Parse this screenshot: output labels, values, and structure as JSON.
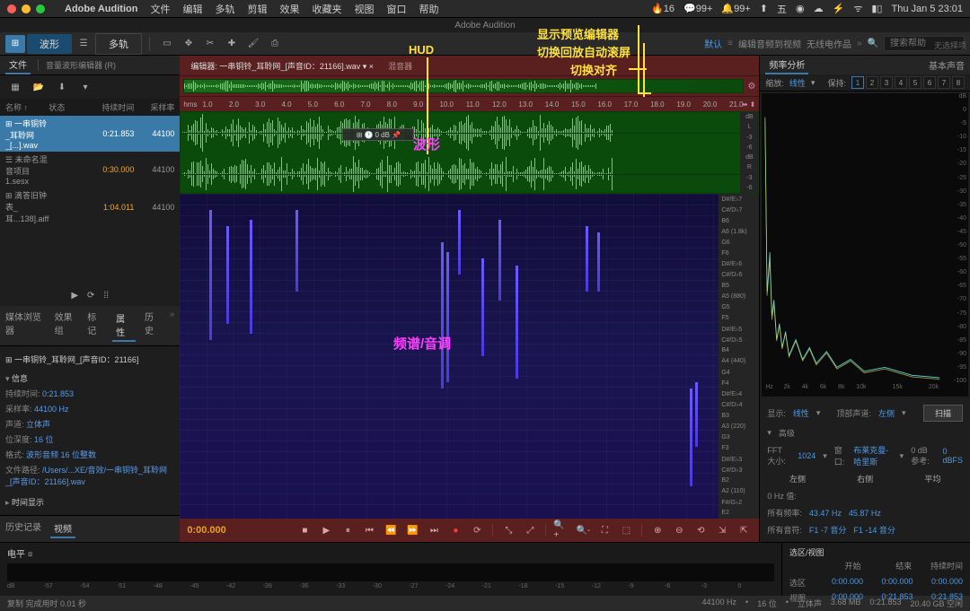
{
  "mac_menu": {
    "app": "Adobe Audition",
    "items": [
      "文件",
      "编辑",
      "多轨",
      "剪辑",
      "效果",
      "收藏夹",
      "视图",
      "窗口",
      "帮助"
    ],
    "right_status": [
      "16",
      "99+",
      "99+",
      "五"
    ],
    "datetime": "Thu Jan 5  23:01"
  },
  "window_title": "Adobe Audition",
  "toolbar": {
    "mode_wave": "波形",
    "mode_multi": "多轨",
    "ws_default": "默认",
    "ws_edit_audio": "编辑音频到视频",
    "ws_radio": "无线电作品",
    "search_placeholder": "搜索帮助"
  },
  "left": {
    "file_tab": "文件",
    "sub_header": "音量波形编辑器 (R)",
    "cols": {
      "name": "名称 ↑",
      "status": "状态",
      "dur": "持续时间",
      "rate": "采样率"
    },
    "files": [
      {
        "name": "一串铜铃_耳聆网_[...].wav",
        "dur": "0:21.853",
        "rate": "44100"
      },
      {
        "name": "未命名混音项目 1.sesx",
        "dur": "0:30.000",
        "rate": "44100"
      },
      {
        "name": "滴答旧钟表_耳...138].aiff",
        "dur": "1:04.011",
        "rate": "44100"
      }
    ],
    "tabs": [
      "媒体浏览器",
      "效果组",
      "标记",
      "属性",
      "历史"
    ],
    "info_title": "一串铜铃_耳聆网_[声音ID：21166]",
    "info_section": "信息",
    "info": {
      "duration_l": "持续时间:",
      "duration": "0:21.853",
      "rate_l": "采样率:",
      "rate": "44100 Hz",
      "channels_l": "声道:",
      "channels": "立体声",
      "depth_l": "位深度:",
      "depth": "16 位",
      "format_l": "格式:",
      "format": "波形音频 16 位整数",
      "path_l": "文件路径:",
      "path": "/Users/...XE/音效/一串铜铃_耳聆网_[声音ID：21166].wav"
    },
    "time_display": "时间显示",
    "history_tab_l": "历史记录",
    "history_tab_r": "视频"
  },
  "center": {
    "tab_prefix": "编辑器:",
    "tab_file": "一串铜铃_耳聆网_[声音ID：21166].wav",
    "tab_mixer": "混音器",
    "hms": "hms",
    "time_marks": [
      "1.0",
      "2.0",
      "3.0",
      "4.0",
      "5.0",
      "6.0",
      "7.0",
      "8.0",
      "9.0",
      "10.0",
      "11.0",
      "12.0",
      "13.0",
      "14.0",
      "15.0",
      "16.0",
      "17.0",
      "18.0",
      "19.0",
      "20.0",
      "21.0"
    ],
    "db_marks": [
      "dB",
      "L",
      "-3",
      "-6",
      "dB",
      "R",
      "-3",
      "-6"
    ],
    "hud": "0 dB",
    "notes": [
      "D#/E♭7",
      "C#/D♭7",
      "B6",
      "A6 (1.8k)",
      "G6",
      "F6",
      "D#/E♭6",
      "C#/D♭6",
      "B5",
      "A5 (880)",
      "G5",
      "F5",
      "D#/E♭5",
      "C#/D♭5",
      "B4",
      "A4 (440)",
      "G4",
      "F4",
      "D#/E♭4",
      "C#/D♭4",
      "B3",
      "A3 (220)",
      "G3",
      "F3",
      "D#/E♭3",
      "C#/D♭3",
      "B2",
      "A2 (110)",
      "F#/G♭2",
      "E2"
    ],
    "timecode": "0:00.000"
  },
  "right": {
    "freq_tab": "频率分析",
    "basic_tab": "基本声音",
    "no_selection": "无选择项",
    "scale_l": "缩放:",
    "scale_v": "线性",
    "hold": "保持:",
    "nums": [
      "1",
      "2",
      "3",
      "4",
      "5",
      "6",
      "7",
      "8"
    ],
    "hz_marks": [
      "Hz",
      "2k",
      "4k",
      "6k",
      "8k",
      "10k",
      "",
      "15k",
      "",
      "20k"
    ],
    "db_marks": [
      "dB",
      "0",
      "-5",
      "-10",
      "-15",
      "-20",
      "-25",
      "-30",
      "-35",
      "-40",
      "-45",
      "-50",
      "-55",
      "-60",
      "-65",
      "-70",
      "-75",
      "-80",
      "-85",
      "-90",
      "-95",
      "-100"
    ],
    "display_l": "显示:",
    "display_v": "线性",
    "topch_l": "顶部声道:",
    "topch_v": "左侧",
    "scan_btn": "扫描",
    "advanced": "高级",
    "fft_l": "FFT 大小:",
    "fft_v": "1024",
    "win_l": "窗口:",
    "win_v": "布莱克曼-哈里斯",
    "ref_l": "0 dB 参考:",
    "ref_v": "0 dBFS",
    "ch_left": "左侧",
    "ch_right": "右侧",
    "ch_avg": "平均",
    "hz_peak_l": "0 Hz 值:",
    "freq_all_l": "所有频率:",
    "freq_all_v1": "43.47 Hz",
    "freq_all_v2": "45.87 Hz",
    "note_all_l": "所有音符:",
    "note_all_v1": "F1 -7 音分",
    "note_all_v2": "F1 -14 音分"
  },
  "level": {
    "tab": "电平",
    "marks": [
      "dB",
      "-57",
      "-54",
      "-51",
      "-48",
      "-45",
      "-42",
      "-39",
      "-36",
      "-33",
      "-30",
      "-27",
      "-24",
      "-21",
      "-18",
      "-15",
      "-12",
      "-9",
      "-6",
      "-3",
      "0"
    ]
  },
  "selection": {
    "title": "选区/视图",
    "cols": [
      "开始",
      "结束",
      "持续时间"
    ],
    "sel_l": "选区",
    "sel": [
      "0:00.000",
      "0:00.000",
      "0:00.000"
    ],
    "view_l": "视图",
    "view": [
      "0:00.000",
      "0:21.853",
      "0:21.853"
    ]
  },
  "status": {
    "left": "复制 完成用时 0.01 秒",
    "items": [
      "44100 Hz",
      "16 位",
      "立体声",
      "3.68 MB",
      "0:21.853",
      "20.40 GB 空闲"
    ]
  },
  "annotations": {
    "hud": "HUD",
    "preview_editor": "显示预览编辑器",
    "auto_scroll": "切换回放自动滚屏",
    "snap": "切换对齐",
    "waveform": "波形",
    "spectral": "频谱/音调"
  }
}
